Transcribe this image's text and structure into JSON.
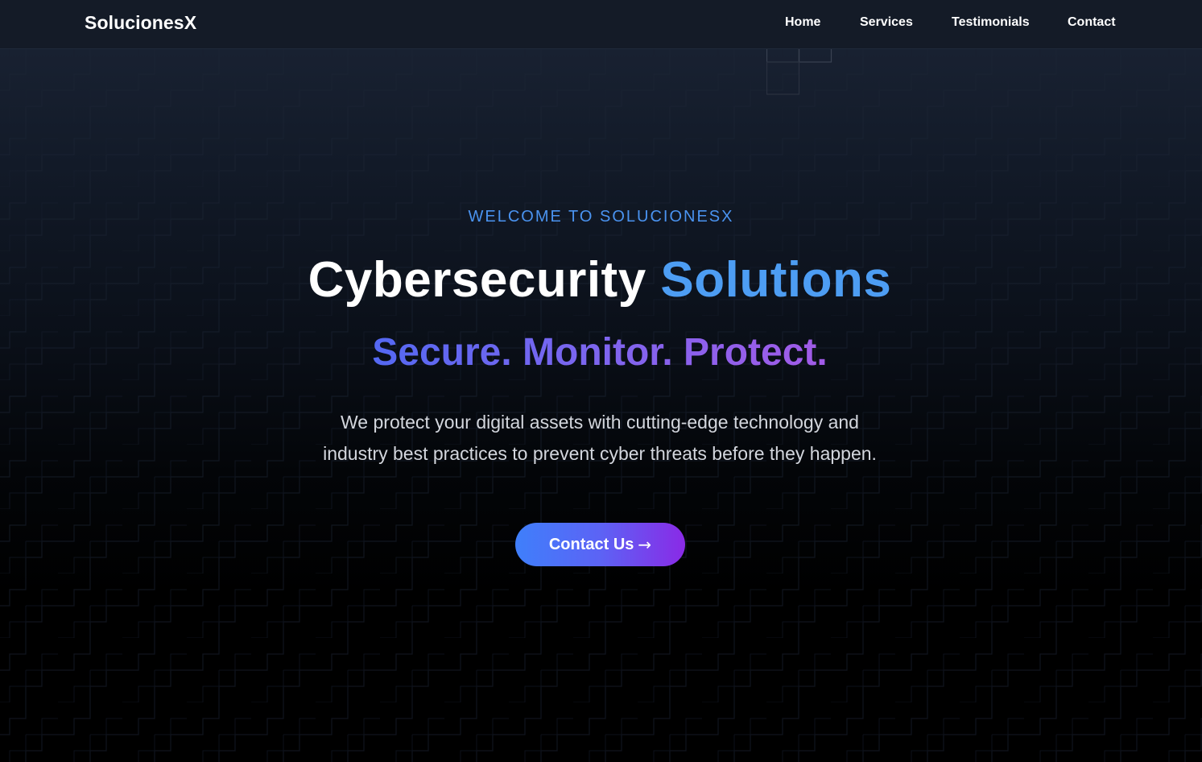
{
  "navbar": {
    "brand": "SolucionesX",
    "links": [
      {
        "label": "Home"
      },
      {
        "label": "Services"
      },
      {
        "label": "Testimonials"
      },
      {
        "label": "Contact"
      }
    ]
  },
  "hero": {
    "eyebrow": "WELCOME TO SOLUCIONESX",
    "headline_main": "Cybersecurity",
    "headline_accent": "Solutions",
    "tagline": "Secure. Monitor. Protect.",
    "description": "We protect your digital assets with cutting-edge technology and industry best practices to prevent cyber threats before they happen.",
    "cta_label": "Contact Us",
    "cta_icon": "arrow-right-icon",
    "cta_arrow": "→"
  },
  "colors": {
    "accent_blue": "#4d9df3",
    "gradient_start": "#3f7ffb",
    "gradient_end": "#8a2ae6",
    "background": "#000000",
    "navbar_bg": "#141b27"
  }
}
